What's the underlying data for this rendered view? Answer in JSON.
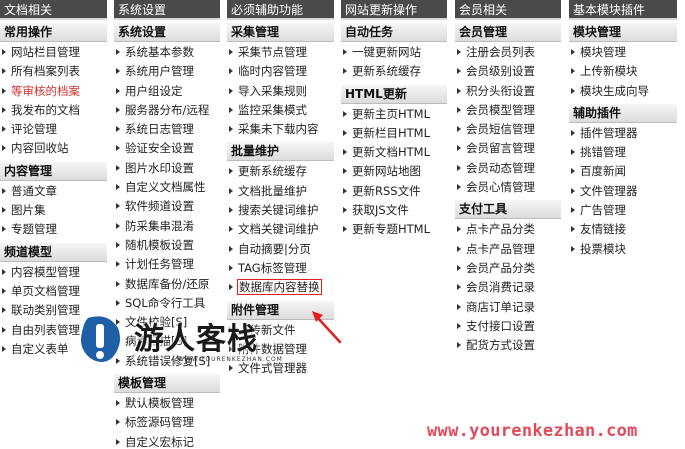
{
  "columns": [
    {
      "title": "文档相关",
      "sections": [
        {
          "title": "常用操作",
          "items": [
            "网站栏目管理",
            "所有档案列表",
            "等审核的档案",
            "我发布的文档",
            "评论管理",
            "内容回收站"
          ]
        },
        {
          "title": "内容管理",
          "items": [
            "普通文章",
            "图片集",
            "专题管理"
          ]
        },
        {
          "title": "频道模型",
          "items": [
            "内容模型管理",
            "单页文档管理",
            "联动类别管理",
            "自由列表管理",
            "自定义表单"
          ]
        }
      ]
    },
    {
      "title": "系统设置",
      "sections": [
        {
          "title": "系统设置",
          "items": [
            "系统基本参数",
            "系统用户管理",
            "用户组设定",
            "服务器分布/远程",
            "系统日志管理",
            "验证安全设置",
            "图片水印设置",
            "自定义文档属性",
            "软件频道设置",
            "防采集串混淆",
            "随机模板设置",
            "计划任务管理",
            "数据库备份/还原",
            "SQL命令行工具",
            "文件校验[S]",
            "病毒扫描[S]",
            "系统错误修复[S]"
          ]
        },
        {
          "title": "模板管理",
          "items": [
            "默认模板管理",
            "标签源码管理",
            "自定义宏标记"
          ]
        }
      ]
    },
    {
      "title": "必须辅助功能",
      "sections": [
        {
          "title": "采集管理",
          "items": [
            "采集节点管理",
            "临时内容管理",
            "导入采集规则",
            "监控采集模式",
            "采集未下载内容"
          ]
        },
        {
          "title": "批量维护",
          "items": [
            "更新系统缓存",
            "文档批量维护",
            "搜索关键词维护",
            "文档关键词维护",
            "自动摘要|分页",
            "TAG标签管理",
            "数据库内容替换"
          ]
        },
        {
          "title": "附件管理",
          "items": [
            "上传新文件",
            "附件数据管理",
            "文件式管理器"
          ]
        }
      ]
    },
    {
      "title": "网站更新操作",
      "sections": [
        {
          "title": "自动任务",
          "items": [
            "一键更新网站",
            "更新系统缓存"
          ]
        },
        {
          "title": "HTML更新",
          "items": [
            "更新主页HTML",
            "更新栏目HTML",
            "更新文档HTML",
            "更新网站地图",
            "更新RSS文件",
            "获取JS文件",
            "更新专题HTML"
          ]
        }
      ]
    },
    {
      "title": "会员相关",
      "sections": [
        {
          "title": "会员管理",
          "items": [
            "注册会员列表",
            "会员级别设置",
            "积分头衔设置",
            "会员模型管理",
            "会员短信管理",
            "会员留言管理",
            "会员动态管理",
            "会员心情管理"
          ]
        },
        {
          "title": "支付工具",
          "items": [
            "点卡产品分类",
            "点卡产品管理",
            "会员产品分类",
            "会员消费记录",
            "商店订单记录",
            "支付接口设置",
            "配货方式设置"
          ]
        }
      ]
    },
    {
      "title": "基本模块插件",
      "sections": [
        {
          "title": "模块管理",
          "items": [
            "模块管理",
            "上传新模块",
            "模块生成向导"
          ]
        },
        {
          "title": "辅助插件",
          "items": [
            "插件管理器",
            "挑错管理",
            "百度新闻",
            "文件管理器",
            "广告管理",
            "友情链接",
            "投票模块"
          ]
        }
      ]
    }
  ],
  "highlight_color": "#d0312d",
  "watermark": {
    "name": "游人客栈",
    "url_small": "WWW.YOURENKEZHAN.COM",
    "url_large": "www.yourenkezhan.com",
    "color": "#e34b5d"
  }
}
